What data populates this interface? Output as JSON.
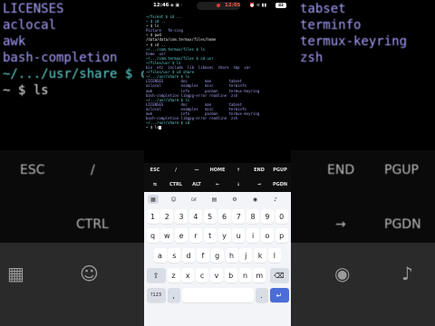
{
  "status_bar": {
    "time": "12:46",
    "recording_time": "12:05",
    "battery": "83"
  },
  "terminal": {
    "lines": [
      {
        "text": "~/fs/ent $ cd ..",
        "style": "path"
      },
      {
        "text": "~ $ cd ..",
        "style": "path"
      },
      {
        "text": "~ $ ls",
        "style": "cmd"
      },
      {
        "text": "Picture   fm-sing",
        "style": "dim"
      },
      {
        "text": "~ $ pwd",
        "style": "cmd"
      },
      {
        "text": "/data/data/com.termux/files/home",
        "style": "cmd"
      },
      {
        "text": "~ $ cd ..",
        "style": "cmd"
      },
      {
        "text": "~/.../com.termux/files $ ls",
        "style": "path"
      },
      {
        "text": "home  usr",
        "style": "dim"
      },
      {
        "text": "~/.../com.termux/files $ cd usr",
        "style": "path"
      },
      {
        "text": "~/files/usr $ ls",
        "style": "path"
      },
      {
        "text": "bin  etc  include  lib  libexec  share  tmp  var",
        "style": "dim"
      },
      {
        "text": "~/files/usr $ cd share",
        "style": "path"
      },
      {
        "text": "~/.../usr/share $ ls",
        "style": "path"
      },
      {
        "text": "LICENSES        doc        man        tabset",
        "style": "dim"
      },
      {
        "text": "aclocal         examples   misc       terminfo",
        "style": "dim"
      },
      {
        "text": "awk             info       pacman     termux-keyring",
        "style": "dim"
      },
      {
        "text": "bash-completion libgpg-error readline  zsh",
        "style": "dim"
      },
      {
        "text": "~/.../usr/share $ ls",
        "style": "path"
      },
      {
        "text": "LICENSES        doc        man        tabset",
        "style": "dim"
      },
      {
        "text": "aclocal         examples   misc       terminfo",
        "style": "dim"
      },
      {
        "text": "awk             info       pacman     termux-keyring",
        "style": "dim"
      },
      {
        "text": "bash-completion libgpg-error readline  zsh",
        "style": "dim"
      },
      {
        "text": "~/.../usr/share $ cd",
        "style": "path"
      },
      {
        "text": "~ $ ls",
        "style": "cmd"
      }
    ]
  },
  "extra_keys": {
    "row1": [
      "ESC",
      "/",
      "—",
      "HOME",
      "↑",
      "END",
      "PGUP"
    ],
    "row2": [
      "⇆",
      "CTRL",
      "ALT",
      "←",
      "↓",
      "→",
      "PGDN"
    ]
  },
  "keyboard": {
    "toolbar": [
      {
        "icon": "grid-icon",
        "glyph": "▦"
      },
      {
        "icon": "sticker-icon",
        "glyph": "☺"
      },
      {
        "icon": "gif-icon",
        "glyph": "GIF"
      },
      {
        "icon": "clipboard-icon",
        "glyph": "▤"
      },
      {
        "icon": "settings-icon",
        "glyph": "⚙"
      },
      {
        "icon": "palette-icon",
        "glyph": "◉"
      },
      {
        "icon": "mic-icon",
        "glyph": "♪"
      }
    ],
    "row_numbers": [
      "1",
      "2",
      "3",
      "4",
      "5",
      "6",
      "7",
      "8",
      "9",
      "0"
    ],
    "row_top": [
      "q",
      "w",
      "e",
      "r",
      "t",
      "y",
      "u",
      "i",
      "o",
      "p"
    ],
    "row_mid": [
      "a",
      "s",
      "d",
      "f",
      "g",
      "h",
      "j",
      "k",
      "l"
    ],
    "row_bottom": [
      "z",
      "x",
      "c",
      "v",
      "b",
      "n",
      "m"
    ],
    "shift": "⇧",
    "backspace": "⌫",
    "symbols": "!?#",
    "numeric": "?123",
    "comma": ",",
    "period": ".",
    "enter": "↵"
  },
  "background_left": {
    "lines": [
      {
        "text": "LICENSES",
        "style": "default"
      },
      {
        "text": "aclocal",
        "style": "default"
      },
      {
        "text": "awk",
        "style": "default"
      },
      {
        "text": "bash-completion",
        "style": "default"
      },
      {
        "text": "~/.../usr/share $ cd",
        "style": "path"
      },
      {
        "text": "~ $ ls",
        "style": "cmd"
      }
    ],
    "extra_row1": [
      "ESC",
      "/"
    ],
    "extra_row2": [
      "CTRL"
    ]
  },
  "background_right": {
    "lines": [
      {
        "text": "tabset",
        "style": "default"
      },
      {
        "text": "terminfo",
        "style": "default"
      },
      {
        "text": "termux-keyring",
        "style": "default"
      },
      {
        "text": "zsh",
        "style": "default"
      }
    ],
    "extra_row1": [
      "END",
      "PGUP"
    ],
    "extra_row2": [
      "→",
      "PGDN"
    ]
  }
}
